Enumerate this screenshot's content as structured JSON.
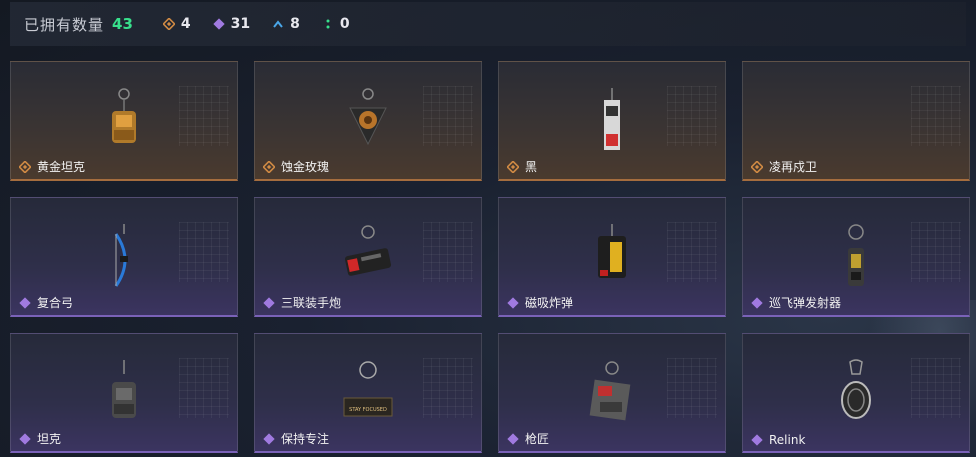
{
  "header": {
    "owned_label": "已拥有数量",
    "owned_count": "43",
    "rarities": [
      {
        "icon": "gold-rarity-icon",
        "count": "4",
        "color": "#d08a44"
      },
      {
        "icon": "purple-rarity-icon",
        "count": "31",
        "color": "#a07ae0"
      },
      {
        "icon": "blue-rarity-icon",
        "count": "8",
        "color": "#4aa6e8"
      },
      {
        "icon": "green-rarity-icon",
        "count": "0",
        "color": "#38e08c"
      }
    ]
  },
  "items": [
    {
      "name": "黄金坦克",
      "rarity": "gold",
      "charm": "gold-tank-charm"
    },
    {
      "name": "蚀金玫瑰",
      "rarity": "gold",
      "charm": "rose-charm"
    },
    {
      "name": "黑",
      "rarity": "gold",
      "charm": "black-tag-charm"
    },
    {
      "name": "凌再戍卫",
      "rarity": "gold",
      "charm": "empty"
    },
    {
      "name": "复合弓",
      "rarity": "purple",
      "charm": "bow-charm"
    },
    {
      "name": "三联装手炮",
      "rarity": "purple",
      "charm": "hand-cannon-charm"
    },
    {
      "name": "磁吸炸弹",
      "rarity": "purple",
      "charm": "magnet-bomb-charm"
    },
    {
      "name": "巡飞弹发射器",
      "rarity": "purple",
      "charm": "loitering-launcher-charm"
    },
    {
      "name": "坦克",
      "rarity": "purple",
      "charm": "tank-charm"
    },
    {
      "name": "保持专注",
      "rarity": "purple",
      "charm": "stay-focused-charm"
    },
    {
      "name": "枪匠",
      "rarity": "purple",
      "charm": "gunsmith-charm"
    },
    {
      "name": "Relink",
      "rarity": "purple",
      "charm": "relink-charm"
    }
  ],
  "charm_text": {
    "stay_focused": "STAY FOCUSED"
  }
}
